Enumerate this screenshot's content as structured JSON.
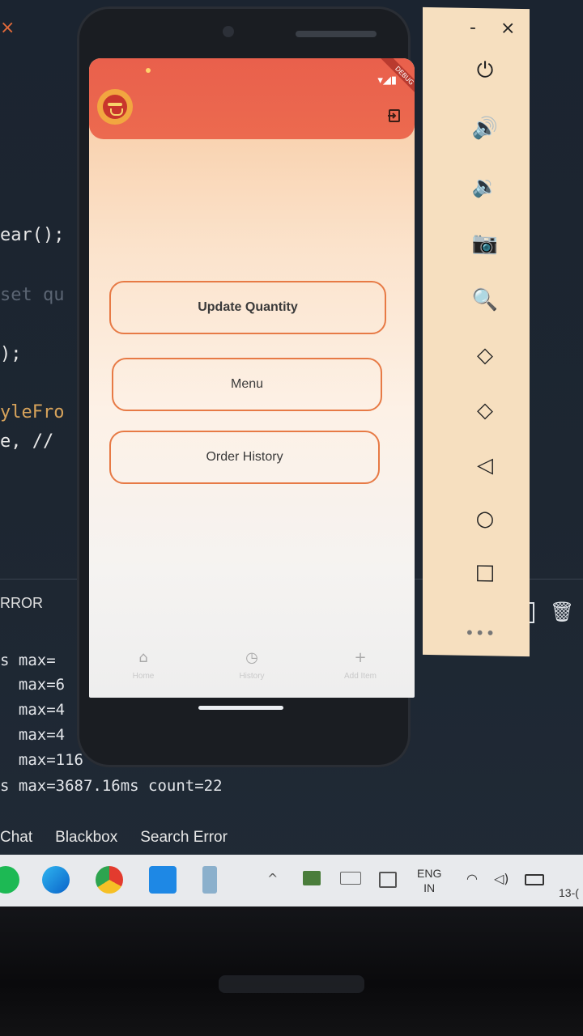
{
  "editor": {
    "code_lines": [
      {
        "text": "ear();",
        "style": "plain"
      },
      {
        "text": "set qu",
        "style": "dim"
      },
      {
        "text": ");",
        "style": "plain"
      },
      {
        "text": "yleFro",
        "style": "orange"
      },
      {
        "text": "e, //",
        "style": "plain"
      }
    ],
    "panel_title": "RROR",
    "perf_lines": [
      "s max=",
      "  max=6",
      "  max=4",
      "  max=4",
      "  max=116",
      "s max=3687.16ms count=22"
    ],
    "bottom_tabs": [
      "Chat",
      "Blackbox",
      "Search Error"
    ]
  },
  "taskbar": {
    "lang_top": "ENG",
    "lang_bottom": "IN",
    "date": "13-("
  },
  "app": {
    "buttons": {
      "update_quantity": "Update Quantity",
      "menu": "Menu",
      "order_history": "Order History"
    },
    "bottom_nav": [
      {
        "icon": "home-icon",
        "glyph": "⌂",
        "label": "Home"
      },
      {
        "icon": "history-icon",
        "glyph": "◷",
        "label": "History"
      },
      {
        "icon": "add-icon",
        "glyph": "+",
        "label": "Add Item"
      }
    ],
    "debug_banner": "DEBUG"
  },
  "emulator_toolbar": {
    "minimize": "-",
    "close": "×",
    "more": "•••"
  },
  "colors": {
    "appbar": "#e9604c",
    "button_border": "#e77a45",
    "toolbar_bg": "#f6dfbf"
  }
}
